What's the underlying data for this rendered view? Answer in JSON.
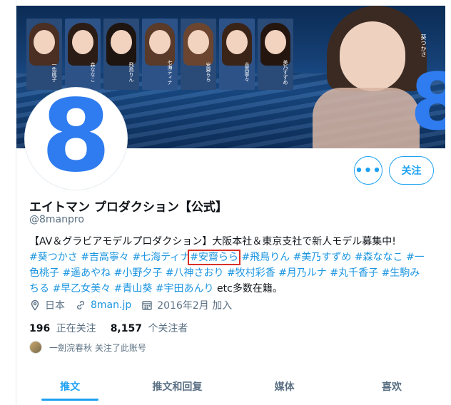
{
  "banner": {
    "model_names": [
      "一色桃子",
      "森ななこ",
      "飛鳥りん",
      "七海ティナ",
      "安齋らら",
      "吉高寧々",
      "美乃すずめ"
    ],
    "hero_name": "葵つかさ",
    "brand_mark": "8"
  },
  "avatar": {
    "mark": "8"
  },
  "actions": {
    "more_label": "•••",
    "follow_label": "关注"
  },
  "profile": {
    "display_name": "エイトマン プロダクション【公式】",
    "handle": "@8manpro"
  },
  "bio": {
    "line1": "【AV＆グラビアモデルプロダクション】大阪本社＆東京支社で新人モデル募集中!",
    "tags_row_a": [
      "#葵つかさ",
      "#吉高寧々",
      "#七海ティナ"
    ],
    "highlighted_tag": "#安齋らら",
    "tags_row_b": [
      "#飛鳥りん",
      "#美乃すずめ",
      "#森ななこ"
    ],
    "tag_wrap_start": "#一",
    "tag_wrap_end": "色桃子",
    "tags_row_c": [
      "#遥あやね",
      "#小野夕子",
      "#八神さおり",
      "#牧村彩香",
      "#月乃ルナ",
      "#丸千香子",
      "#生駒み"
    ],
    "tag_wrap2_end": "ちる",
    "tags_row_d": [
      "#早乙女美々",
      "#青山葵",
      "#宇田あんり"
    ],
    "suffix": "etc多数在籍。"
  },
  "meta": {
    "location": "日本",
    "link": "8man.jp",
    "joined": "2016年2月 加入"
  },
  "stats": {
    "following_count": "196",
    "following_label": "正在关注",
    "followers_count": "8,157",
    "followers_label": "个关注者"
  },
  "followed_by": {
    "text": "一劍浣春秋 关注了此账号"
  },
  "tabs": [
    {
      "label": "推文"
    },
    {
      "label": "推文和回复"
    },
    {
      "label": "媒体"
    },
    {
      "label": "喜欢"
    }
  ],
  "colors": {
    "accent": "#1da1f2",
    "link": "#1b95e0",
    "highlight_box": "#d93025",
    "brand_blue": "#2f7cf0"
  }
}
